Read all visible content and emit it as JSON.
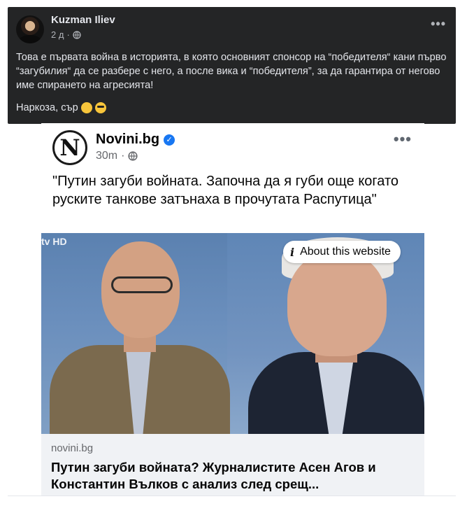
{
  "post": {
    "author": "Kuzman Iliev",
    "time": "2 д",
    "more": "•••",
    "text": "Това е първата война в историята, в която основният спонсор на “победителя“ кани първо “загубилия“ да се разбере с него, а после вика и “победителя”, за да гарантира от негово име спирането на агресията!",
    "text2": "Наркоза, сър"
  },
  "shared": {
    "page_name": "Novini.bg",
    "logo_letter": "N",
    "time": "30m",
    "more": "•••",
    "text": "\"Путин загуби войната. Започна да я губи още когато руските танкове затънаха в прочутата Распутица\"",
    "tv_logo": "tv HD",
    "about_label": "About this website",
    "link_domain": "novini.bg",
    "link_title": "Путин загуби войната? Журналистите Асен Агов и Константин Вълков с анализ след срещ..."
  },
  "colors": {
    "dark_bg": "#242526",
    "verified": "#1877f2",
    "link_bg": "#f0f2f5"
  }
}
